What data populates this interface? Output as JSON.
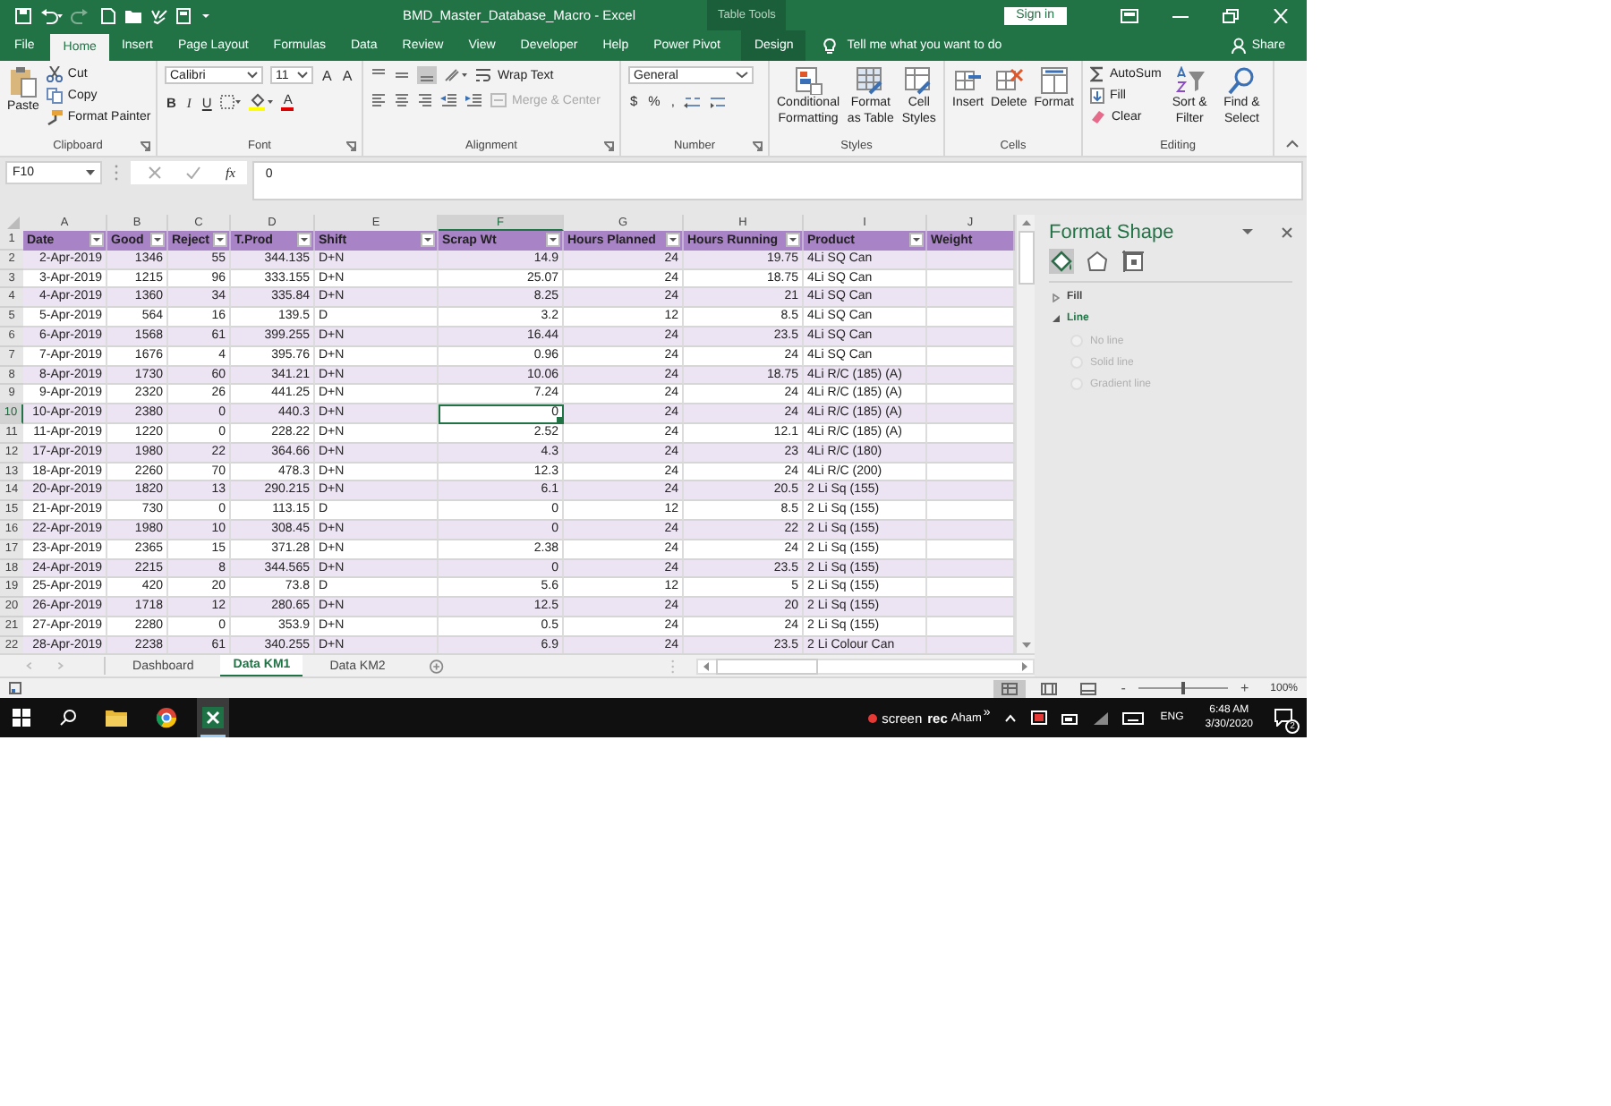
{
  "window": {
    "title": "BMD_Master_Database_Macro  -  Excel",
    "contextual_label": "Table Tools",
    "sign_in": "Sign in"
  },
  "tabs": [
    {
      "label": "File",
      "selected": false,
      "kind": "normal"
    },
    {
      "label": "Home",
      "selected": true,
      "kind": "normal"
    },
    {
      "label": "Insert",
      "selected": false,
      "kind": "normal"
    },
    {
      "label": "Page Layout",
      "selected": false,
      "kind": "normal"
    },
    {
      "label": "Formulas",
      "selected": false,
      "kind": "normal"
    },
    {
      "label": "Data",
      "selected": false,
      "kind": "normal"
    },
    {
      "label": "Review",
      "selected": false,
      "kind": "normal"
    },
    {
      "label": "View",
      "selected": false,
      "kind": "normal"
    },
    {
      "label": "Developer",
      "selected": false,
      "kind": "normal"
    },
    {
      "label": "Help",
      "selected": false,
      "kind": "normal"
    },
    {
      "label": "Power Pivot",
      "selected": false,
      "kind": "normal"
    },
    {
      "label": "Design",
      "selected": false,
      "kind": "contextual"
    }
  ],
  "tell_me": {
    "placeholder": "Tell me what you want to do"
  },
  "share": "Share",
  "ribbon": {
    "clipboard": {
      "name": "Clipboard",
      "paste": "Paste",
      "cut": "Cut",
      "copy": "Copy",
      "format_painter": "Format Painter"
    },
    "font": {
      "name": "Font",
      "font_name": "Calibri",
      "font_size": "11",
      "grow": "A",
      "shrink": "A",
      "bold": "B",
      "italic": "I",
      "underline": "U",
      "font_color": "A"
    },
    "alignment": {
      "name": "Alignment",
      "wrap_text": "Wrap Text",
      "merge_center": {
        "label": "Merge & Center",
        "disabled": true
      }
    },
    "number": {
      "name": "Number",
      "format": "General",
      "currency": "$",
      "percent": "%",
      "comma": ","
    },
    "styles": {
      "name": "Styles",
      "buttons": [
        "Conditional Formatting",
        "Format as Table",
        "Cell Styles"
      ]
    },
    "cells": {
      "name": "Cells",
      "buttons": [
        "Insert",
        "Delete",
        "Format"
      ]
    },
    "editing": {
      "name": "Editing",
      "autosum": "AutoSum",
      "fill": "Fill",
      "clear": "Clear",
      "sort_filter": "Sort & Filter",
      "find_select": "Find & Select"
    }
  },
  "formula_bar": {
    "name_box": "F10",
    "function_label": "fx",
    "value": "0"
  },
  "table": {
    "columns": [
      {
        "letter": "A",
        "header": "Date",
        "kind": "date",
        "selected": false
      },
      {
        "letter": "B",
        "header": "Good",
        "kind": "number",
        "selected": false
      },
      {
        "letter": "C",
        "header": "Reject",
        "kind": "number",
        "selected": false
      },
      {
        "letter": "D",
        "header": "T.Prod",
        "kind": "number",
        "selected": false
      },
      {
        "letter": "E",
        "header": "Shift",
        "kind": "text",
        "selected": false
      },
      {
        "letter": "F",
        "header": "Scrap Wt",
        "kind": "number",
        "selected": true
      },
      {
        "letter": "G",
        "header": "Hours Planned",
        "kind": "number",
        "selected": false
      },
      {
        "letter": "H",
        "header": "Hours Running",
        "kind": "number",
        "selected": false
      },
      {
        "letter": "I",
        "header": "Product",
        "kind": "text",
        "selected": false
      },
      {
        "letter": "J",
        "header": "Weight",
        "kind": "text",
        "selected": false
      }
    ],
    "header_row_number": "1",
    "rows": [
      {
        "number": "2",
        "selected": false,
        "cells": [
          "2-Apr-2019",
          "1346",
          "55",
          "344.135",
          "D+N",
          "14.9",
          "24",
          "19.75",
          "4Li SQ Can",
          ""
        ]
      },
      {
        "number": "3",
        "selected": false,
        "cells": [
          "3-Apr-2019",
          "1215",
          "96",
          "333.155",
          "D+N",
          "25.07",
          "24",
          "18.75",
          "4Li SQ Can",
          ""
        ]
      },
      {
        "number": "4",
        "selected": false,
        "cells": [
          "4-Apr-2019",
          "1360",
          "34",
          "335.84",
          "D+N",
          "8.25",
          "24",
          "21",
          "4Li SQ Can",
          ""
        ]
      },
      {
        "number": "5",
        "selected": false,
        "cells": [
          "5-Apr-2019",
          "564",
          "16",
          "139.5",
          "D",
          "3.2",
          "12",
          "8.5",
          "4Li SQ Can",
          ""
        ]
      },
      {
        "number": "6",
        "selected": false,
        "cells": [
          "6-Apr-2019",
          "1568",
          "61",
          "399.255",
          "D+N",
          "16.44",
          "24",
          "23.5",
          "4Li SQ Can",
          ""
        ]
      },
      {
        "number": "7",
        "selected": false,
        "cells": [
          "7-Apr-2019",
          "1676",
          "4",
          "395.76",
          "D+N",
          "0.96",
          "24",
          "24",
          "4Li SQ Can",
          ""
        ]
      },
      {
        "number": "8",
        "selected": false,
        "cells": [
          "8-Apr-2019",
          "1730",
          "60",
          "341.21",
          "D+N",
          "10.06",
          "24",
          "18.75",
          "4Li R/C (185) (A)",
          ""
        ]
      },
      {
        "number": "9",
        "selected": false,
        "cells": [
          "9-Apr-2019",
          "2320",
          "26",
          "441.25",
          "D+N",
          "7.24",
          "24",
          "24",
          "4Li R/C (185) (A)",
          ""
        ]
      },
      {
        "number": "10",
        "selected": true,
        "cells": [
          "10-Apr-2019",
          "2380",
          "0",
          "440.3",
          "D+N",
          "0",
          "24",
          "24",
          "4Li R/C (185) (A)",
          ""
        ]
      },
      {
        "number": "11",
        "selected": false,
        "cells": [
          "11-Apr-2019",
          "1220",
          "0",
          "228.22",
          "D+N",
          "2.52",
          "24",
          "12.1",
          "4Li R/C (185) (A)",
          ""
        ]
      },
      {
        "number": "12",
        "selected": false,
        "cells": [
          "17-Apr-2019",
          "1980",
          "22",
          "364.66",
          "D+N",
          "4.3",
          "24",
          "23",
          "4Li R/C (180)",
          ""
        ]
      },
      {
        "number": "13",
        "selected": false,
        "cells": [
          "18-Apr-2019",
          "2260",
          "70",
          "478.3",
          "D+N",
          "12.3",
          "24",
          "24",
          "4Li R/C (200)",
          ""
        ]
      },
      {
        "number": "14",
        "selected": false,
        "cells": [
          "20-Apr-2019",
          "1820",
          "13",
          "290.215",
          "D+N",
          "6.1",
          "24",
          "20.5",
          "2 Li Sq (155)",
          ""
        ]
      },
      {
        "number": "15",
        "selected": false,
        "cells": [
          "21-Apr-2019",
          "730",
          "0",
          "113.15",
          "D",
          "0",
          "12",
          "8.5",
          "2 Li Sq (155)",
          ""
        ]
      },
      {
        "number": "16",
        "selected": false,
        "cells": [
          "22-Apr-2019",
          "1980",
          "10",
          "308.45",
          "D+N",
          "0",
          "24",
          "22",
          "2 Li Sq (155)",
          ""
        ]
      },
      {
        "number": "17",
        "selected": false,
        "cells": [
          "23-Apr-2019",
          "2365",
          "15",
          "371.28",
          "D+N",
          "2.38",
          "24",
          "24",
          "2 Li Sq (155)",
          ""
        ]
      },
      {
        "number": "18",
        "selected": false,
        "cells": [
          "24-Apr-2019",
          "2215",
          "8",
          "344.565",
          "D+N",
          "0",
          "24",
          "23.5",
          "2 Li Sq (155)",
          ""
        ]
      },
      {
        "number": "19",
        "selected": false,
        "cells": [
          "25-Apr-2019",
          "420",
          "20",
          "73.8",
          "D",
          "5.6",
          "12",
          "5",
          "2 Li Sq (155)",
          ""
        ]
      },
      {
        "number": "20",
        "selected": false,
        "cells": [
          "26-Apr-2019",
          "1718",
          "12",
          "280.65",
          "D+N",
          "12.5",
          "24",
          "20",
          "2 Li Sq (155)",
          ""
        ]
      },
      {
        "number": "21",
        "selected": false,
        "cells": [
          "27-Apr-2019",
          "2280",
          "0",
          "353.9",
          "D+N",
          "0.5",
          "24",
          "24",
          "2 Li Sq (155)",
          ""
        ]
      },
      {
        "number": "22",
        "selected": false,
        "cells": [
          "28-Apr-2019",
          "2238",
          "61",
          "340.255",
          "D+N",
          "6.9",
          "24",
          "23.5",
          "2 Li Colour Can",
          ""
        ]
      }
    ]
  },
  "sheet_tabs": [
    {
      "label": "Dashboard",
      "selected": false
    },
    {
      "label": "Data KM1",
      "selected": true
    },
    {
      "label": "Data KM2",
      "selected": false
    }
  ],
  "format_pane": {
    "title": "Format Shape",
    "icon_tabs": [
      {
        "selected": true
      },
      {
        "selected": false
      },
      {
        "selected": false
      }
    ],
    "sections": [
      {
        "label": "Fill",
        "expanded": false
      },
      {
        "label": "Line",
        "expanded": true
      }
    ],
    "line_options": [
      {
        "label": "No line",
        "selected": false
      },
      {
        "label": "Solid line",
        "selected": false
      },
      {
        "label": "Gradient line",
        "selected": false
      }
    ]
  },
  "status_bar": {
    "views": [
      {
        "selected": true
      },
      {
        "selected": false
      },
      {
        "selected": false
      }
    ],
    "zoom_out": "-",
    "zoom_in": "+",
    "zoom": {
      "level": 0.5
    },
    "zoom_reading": "100%"
  },
  "taskbar": {
    "recorder": {
      "first": "screen",
      "second": "rec"
    },
    "user": "Aham",
    "more": "»",
    "language": "ENG",
    "time": "6:48 AM",
    "date": "3/30/2020",
    "notifications": "2"
  }
}
